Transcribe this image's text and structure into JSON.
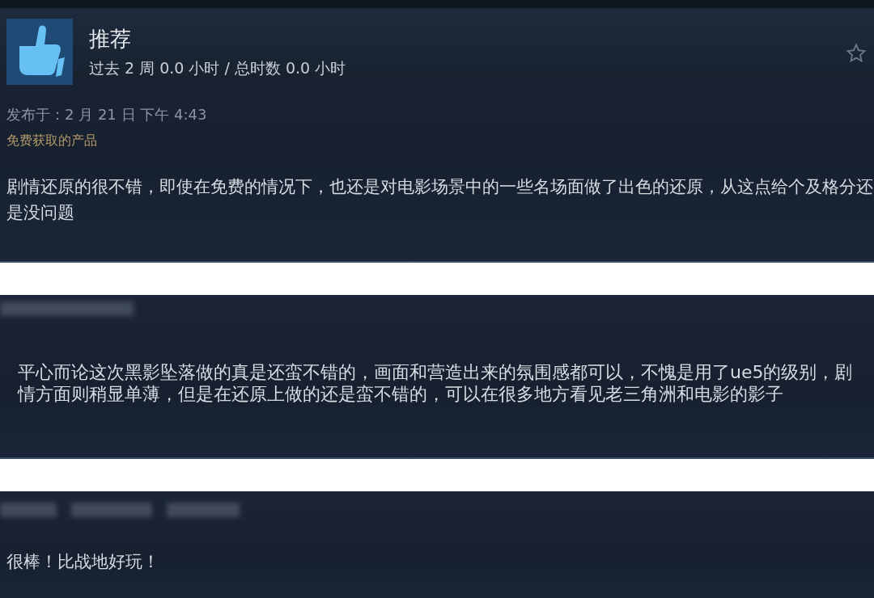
{
  "reviews": [
    {
      "kind": "full",
      "verdict": "推荐",
      "hours": "过去 2 周 0.0 小时 / 总时数 0.0 小时",
      "posted": "发布于：2 月 21 日 下午 4:43",
      "free_note": "免费获取的产品",
      "text": "剧情还原的很不错，即使在免费的情况下，也还是对电影场景中的一些名场面做了出色的还原，从这点给个及格分还是没问题"
    },
    {
      "kind": "blurred",
      "text": "平心而论这次黑影坠落做的真是还蛮不错的，画面和营造出来的氛围感都可以，不愧是用了ue5的级别，剧情方面则稍显单薄，但是在还原上做的还是蛮不错的，可以在很多地方看见老三角洲和电影的影子"
    },
    {
      "kind": "short",
      "text": "很棒！比战地好玩！"
    }
  ]
}
